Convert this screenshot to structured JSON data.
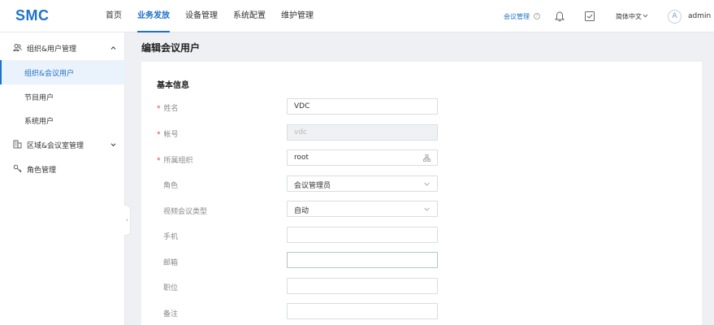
{
  "brand": {
    "logo": "SMC",
    "color": "#1f72c9"
  },
  "nav": {
    "items": [
      "首页",
      "业务发放",
      "设备管理",
      "系统配置",
      "维护管理"
    ],
    "active_index": 1
  },
  "topbar": {
    "help_link": "会议管理",
    "help_icon": "question-circle-icon",
    "notification_icon": "bell-icon",
    "tasks_icon": "checkbox-icon",
    "language": "简体中文",
    "avatar_letter": "A",
    "username": "admin"
  },
  "sidebar": {
    "groups": [
      {
        "label": "组织&用户管理",
        "icon": "users-icon",
        "expanded": true,
        "children": [
          {
            "label": "组织&会议用户",
            "active": true
          },
          {
            "label": "节目用户",
            "active": false
          },
          {
            "label": "系统用户",
            "active": false
          }
        ]
      },
      {
        "label": "区域&会议室管理",
        "icon": "building-icon",
        "expanded": false
      },
      {
        "label": "角色管理",
        "icon": "key-icon",
        "expanded": false
      }
    ],
    "collapse_glyph": "‹"
  },
  "page": {
    "title": "编辑会议用户"
  },
  "form": {
    "section_title": "基本信息",
    "required_mark": "*",
    "fields": [
      {
        "label": "姓名",
        "required": true,
        "value": "VDC",
        "type": "text"
      },
      {
        "label": "帐号",
        "required": true,
        "value": "vdc",
        "type": "text",
        "disabled": true
      },
      {
        "label": "所属组织",
        "required": true,
        "value": "root",
        "type": "picker"
      },
      {
        "label": "角色",
        "required": false,
        "value": "会议管理员",
        "type": "select"
      },
      {
        "label": "视频会议类型",
        "required": false,
        "value": "自动",
        "type": "select"
      },
      {
        "label": "手机",
        "required": false,
        "value": "",
        "type": "text"
      },
      {
        "label": "邮箱",
        "required": false,
        "value": "",
        "type": "text"
      },
      {
        "label": "职位",
        "required": false,
        "value": "",
        "type": "text"
      },
      {
        "label": "备注",
        "required": false,
        "value": "",
        "type": "text"
      }
    ]
  }
}
